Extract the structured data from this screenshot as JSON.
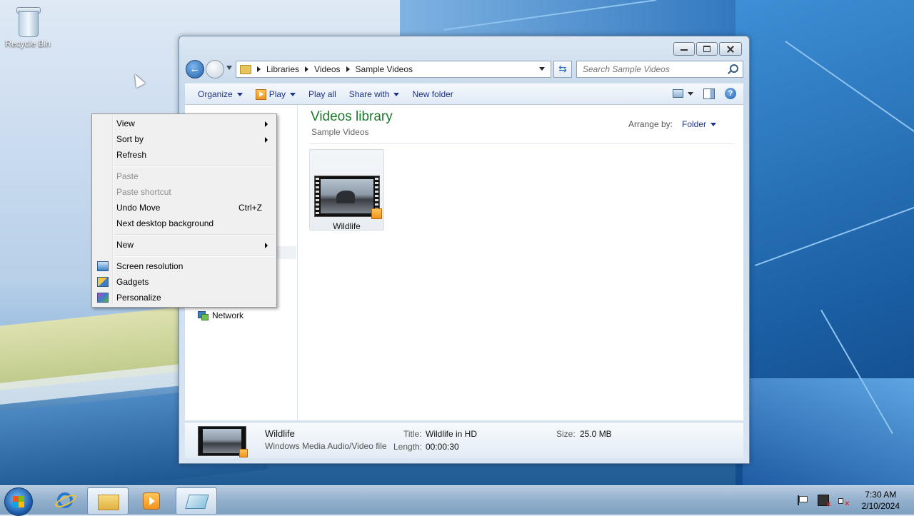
{
  "desktop": {
    "recycle_bin_label": "Recycle Bin"
  },
  "explorer": {
    "breadcrumbs": [
      "Libraries",
      "Videos",
      "Sample Videos"
    ],
    "search_placeholder": "Search Sample Videos",
    "toolbar": {
      "organize": "Organize",
      "play": "Play",
      "play_all": "Play all",
      "share_with": "Share with",
      "new_folder": "New folder"
    },
    "library_title": "Videos library",
    "library_subtitle": "Sample Videos",
    "arrange_label": "Arrange by:",
    "arrange_value": "Folder",
    "nav_items": [
      {
        "label": "Network",
        "icon": "network-icon"
      }
    ],
    "files": [
      {
        "name": "Wildlife",
        "icon": "video-thumbnail"
      }
    ],
    "details": {
      "name": "Wildlife",
      "type": "Windows Media Audio/Video file",
      "title_label": "Title:",
      "title_value": "Wildlife in HD",
      "length_label": "Length:",
      "length_value": "00:00:30",
      "size_label": "Size:",
      "size_value": "25.0 MB"
    }
  },
  "context_menu": {
    "items": [
      {
        "label": "View",
        "submenu": true
      },
      {
        "label": "Sort by",
        "submenu": true
      },
      {
        "label": "Refresh"
      },
      {
        "label": "Paste",
        "disabled": true
      },
      {
        "label": "Paste shortcut",
        "disabled": true
      },
      {
        "label": "Undo Move",
        "shortcut": "Ctrl+Z"
      },
      {
        "label": "Next desktop background"
      },
      {
        "label": "New",
        "submenu": true
      },
      {
        "label": "Screen resolution",
        "icon": "display-icon"
      },
      {
        "label": "Gadgets",
        "icon": "gadgets-icon"
      },
      {
        "label": "Personalize",
        "icon": "personalize-icon"
      }
    ]
  },
  "taskbar": {
    "apps": [
      "start-button",
      "internet-explorer",
      "windows-explorer",
      "windows-media-player",
      "note-app"
    ],
    "clock_time": "7:30 AM",
    "clock_date": "2/10/2024"
  },
  "colors": {
    "library_title": "#1b7a2c",
    "toolbar_text": "#1e3287"
  }
}
